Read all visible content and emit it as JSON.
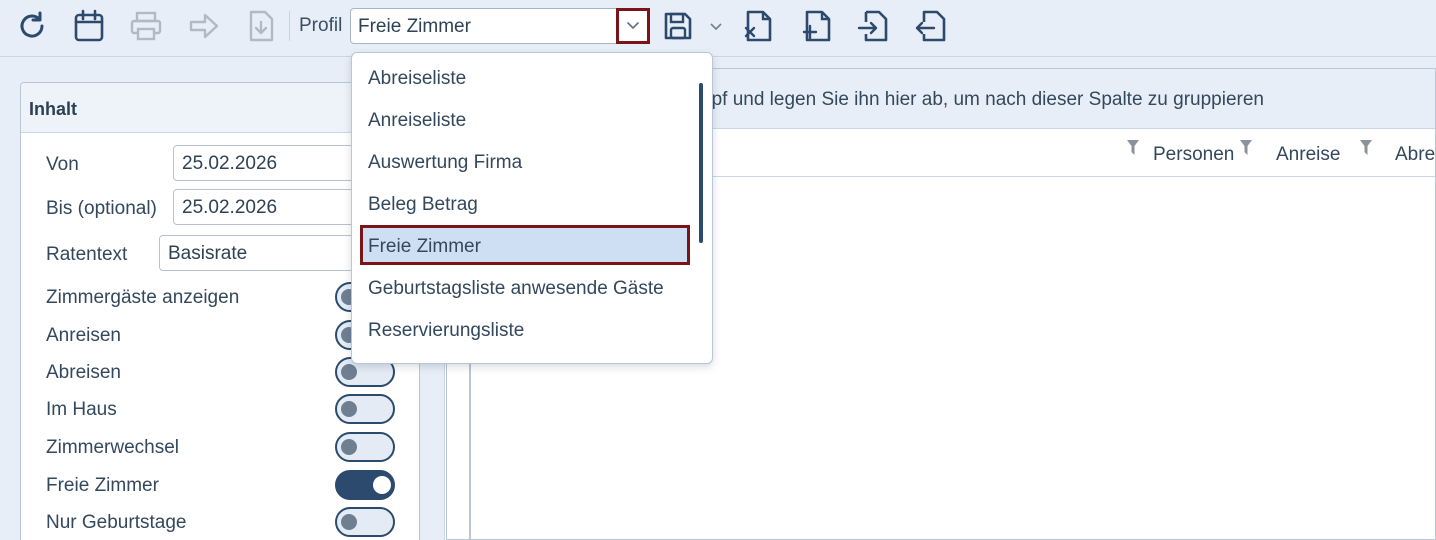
{
  "toolbar": {
    "icons": [
      "refresh-icon",
      "calendar-icon",
      "print-icon",
      "forward-arrow-icon",
      "download-icon",
      "save-icon",
      "excel-export-icon",
      "add-document-icon",
      "import-icon",
      "export-icon"
    ],
    "profil_label": "Profil",
    "profil_value": "Freie Zimmer"
  },
  "dropdown": {
    "options": [
      "Abreiseliste",
      "Anreiseliste",
      "Auswertung Firma",
      "Beleg Betrag",
      "Freie Zimmer",
      "Geburtstagsliste anwesende Gäste",
      "Reservierungsliste"
    ],
    "selected": "Freie Zimmer"
  },
  "inhalt": {
    "title": "Inhalt",
    "von_label": "Von",
    "von_value": "25.02.2026",
    "bis_label": "Bis (optional)",
    "bis_value": "25.02.2026",
    "ratentext_label": "Ratentext",
    "ratentext_value": "Basisrate",
    "toggles": [
      {
        "label": "Zimmergäste anzeigen",
        "on": false
      },
      {
        "label": "Anreisen",
        "on": false
      },
      {
        "label": "Abreisen",
        "on": false
      },
      {
        "label": "Im Haus",
        "on": false
      },
      {
        "label": "Zimmerwechsel",
        "on": false
      },
      {
        "label": "Freie Zimmer",
        "on": true
      },
      {
        "label": "Nur Geburtstage",
        "on": false
      }
    ]
  },
  "grid": {
    "group_hint": "opf und legen Sie ihn hier ab, um nach dieser Spalte zu gruppieren",
    "columns": [
      "Personen",
      "Anreise",
      "Abre"
    ]
  },
  "colors": {
    "accent": "#2c4a6e",
    "highlight_border": "#7a1418",
    "selected_bg": "#cfdff3",
    "toolbar_bg": "#e8eef7"
  }
}
